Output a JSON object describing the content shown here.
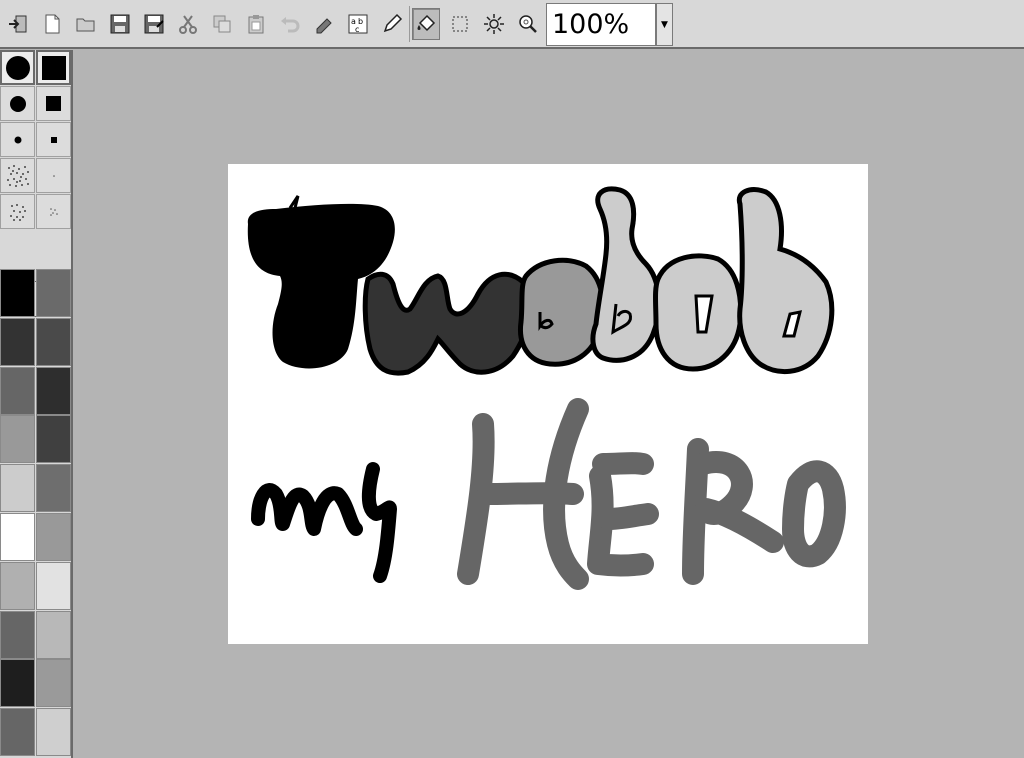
{
  "toolbar": {
    "zoom_value": "100%",
    "tools": [
      {
        "name": "exit-icon"
      },
      {
        "name": "new-icon"
      },
      {
        "name": "open-icon"
      },
      {
        "name": "save-icon"
      },
      {
        "name": "save-as-icon"
      },
      {
        "name": "cut-icon"
      },
      {
        "name": "copy-icon"
      },
      {
        "name": "paste-icon"
      },
      {
        "name": "undo-icon"
      },
      {
        "name": "redo-icon"
      },
      {
        "name": "text-icon"
      },
      {
        "name": "pencil-icon"
      },
      {
        "name": "fill-icon",
        "active": true
      },
      {
        "name": "select-icon"
      },
      {
        "name": "brightness-icon"
      },
      {
        "name": "zoom-icon"
      }
    ]
  },
  "palette": {
    "brushes": [
      "circle-large",
      "square-large",
      "circle-medium",
      "square-medium",
      "circle-small",
      "square-small",
      "spray-large",
      "spray-dot",
      "spray-medium",
      "spray-small"
    ],
    "colors": [
      "#000000",
      "#6a6a6a",
      "#333333",
      "#4a4a4a",
      "#666666",
      "#2e2e2e",
      "#999999",
      "#404040",
      "#cccccc",
      "#6e6e6e",
      "#ffffff",
      "#999999",
      "#b0b0b0",
      "#e2e2e2",
      "#666666",
      "#b8b8b8",
      "#1e1e1e",
      "#9a9a9a",
      "#666666",
      "#cfcfcf"
    ]
  },
  "canvas": {
    "background": "#ffffff"
  }
}
